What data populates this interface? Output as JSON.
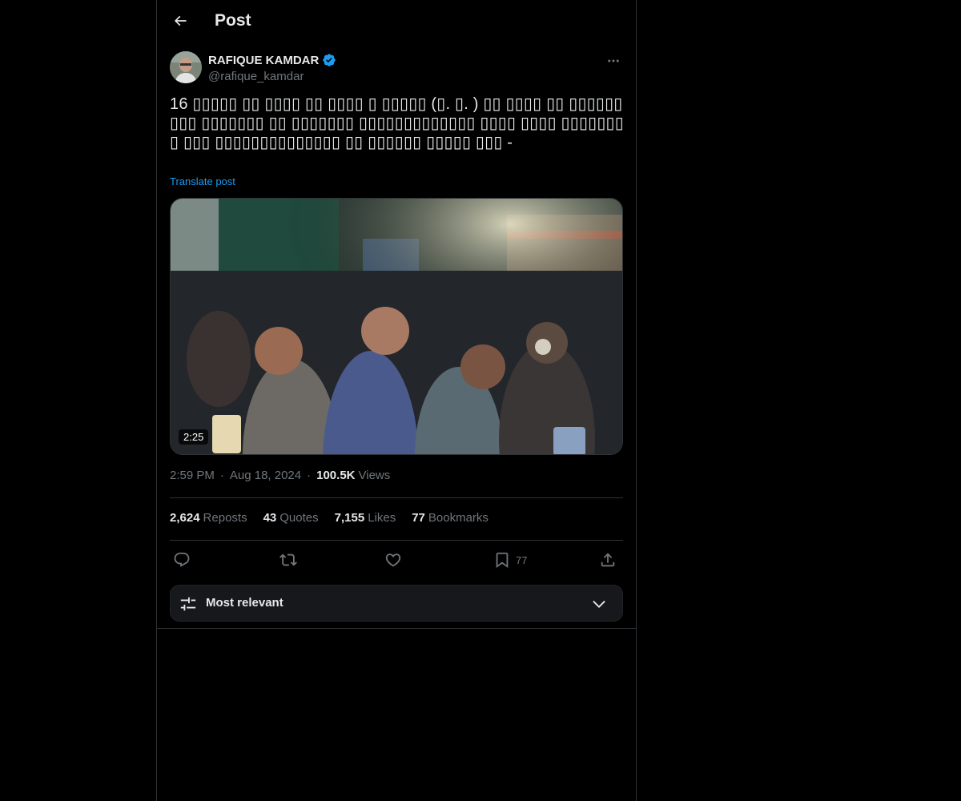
{
  "header": {
    "title": "Post"
  },
  "author": {
    "name": "RAFIQUE KAMDAR",
    "handle": "@rafique_kamdar",
    "verified": true
  },
  "post": {
    "text": "16 ▯▯▯▯▯ ▯▯ ▯▯▯▯ ▯▯ ▯▯▯▯ ▯ ▯▯▯▯▯ (▯. ▯. ) ▯▯ ▯▯▯▯ ▯▯ ▯▯▯▯▯▯▯▯▯ ▯▯▯▯▯▯▯ ▯▯ ▯▯▯▯▯▯▯ ▯▯▯▯▯▯▯▯▯▯▯▯▯ ▯▯▯▯ ▯▯▯▯ ▯▯▯▯▯▯▯▯ ▯▯▯ ▯▯▯▯▯▯▯▯▯▯▯▯▯▯ ▯▯ ▯▯▯▯▯▯ ▯▯▯▯▯ ▯▯▯ -",
    "translate_label": "Translate post",
    "video_duration": "2:25",
    "time": "2:59 PM",
    "date": "Aug 18, 2024",
    "views_count": "100.5K",
    "views_label": "Views"
  },
  "stats": [
    {
      "count": "2,624",
      "label": "Reposts"
    },
    {
      "count": "43",
      "label": "Quotes"
    },
    {
      "count": "7,155",
      "label": "Likes"
    },
    {
      "count": "77",
      "label": "Bookmarks"
    }
  ],
  "actions": {
    "bookmark_count": "77"
  },
  "sort": {
    "label": "Most relevant"
  },
  "colors": {
    "background": "#000000",
    "accent": "#1d9bf0",
    "secondary_text": "#71767b",
    "border": "#2f3336"
  },
  "icons": [
    "back-arrow-icon",
    "verified-badge-icon",
    "more-icon",
    "reply-icon",
    "repost-icon",
    "like-icon",
    "bookmark-icon",
    "share-icon",
    "filter-sliders-icon",
    "chevron-down-icon"
  ]
}
